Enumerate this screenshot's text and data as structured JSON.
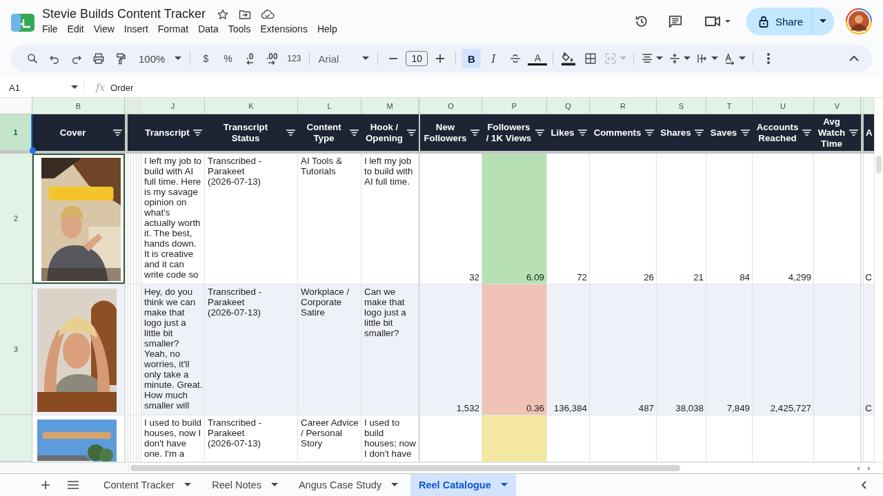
{
  "document": {
    "title": "Stevie Builds Content Tracker"
  },
  "menu": [
    "File",
    "Edit",
    "View",
    "Insert",
    "Format",
    "Data",
    "Tools",
    "Extensions",
    "Help"
  ],
  "share": {
    "label": "Share"
  },
  "toolbar": {
    "zoom": "100%",
    "currency": "$",
    "percent": "%",
    "decrease_decimals": ".0",
    "increase_decimals": ".00",
    "number_format": "123",
    "font": "Arial",
    "font_size": "10",
    "bold": {
      "label": "B",
      "selected": true
    },
    "italic": {
      "label": "I",
      "selected": false
    },
    "strikethrough": {
      "selected": false
    },
    "text_color": {
      "label": "A"
    },
    "merge": {
      "disabled": true
    }
  },
  "formula_bar": {
    "cell": "A1",
    "fx": "fx",
    "value": "Order"
  },
  "header_row": {
    "number": "1"
  },
  "columns": [
    {
      "letter": "B",
      "title": "Cover"
    },
    {
      "letter": "J",
      "title": "Transcript"
    },
    {
      "letter": "K",
      "title": "Transcript Status"
    },
    {
      "letter": "L",
      "title": "Content Type"
    },
    {
      "letter": "M",
      "title": "Hook / Opening"
    },
    {
      "letter": "O",
      "title": "New Followers"
    },
    {
      "letter": "P",
      "title": "Followers / 1K Views"
    },
    {
      "letter": "Q",
      "title": "Likes"
    },
    {
      "letter": "R",
      "title": "Comments"
    },
    {
      "letter": "S",
      "title": "Shares"
    },
    {
      "letter": "T",
      "title": "Saves"
    },
    {
      "letter": "U",
      "title": "Accounts Reached"
    },
    {
      "letter": "V",
      "title": "Avg Watch Time"
    },
    {
      "title": "A"
    }
  ],
  "rows": [
    {
      "number": "2",
      "cover": {
        "kind": "picture",
        "selected": true
      },
      "transcript": "I left my job to build with AI full time. Here is my savage opinion on what's actually worth it. The best, hands down. It is creative and it can write code so",
      "transcript_status": "Transcribed - Parakeet (2026-07-13)",
      "content_type": "AI Tools & Tutorials",
      "hook": "I left my job to build with AI full time.",
      "new_followers": "32",
      "followers_per_1k_views": {
        "text": "6.09",
        "color": "#b7e1b5"
      },
      "likes": "72",
      "comments": "26",
      "shares": "21",
      "saves": "84",
      "accounts_reached": "4,299",
      "column_w": "C"
    },
    {
      "number": "3",
      "cover": {
        "kind": "picture",
        "selected": false
      },
      "transcript": "Hey, do you think we can make that logo just a little bit smaller? Yeah, no worries, it'll only take a minute. Great. How much smaller will",
      "transcript_status": "Transcribed - Parakeet (2026-07-13)",
      "content_type": "Workplace / Corporate Satire",
      "hook": "Can we make that logo just a little bit smaller?",
      "new_followers": "1,532",
      "followers_per_1k_views": {
        "text": "0.36",
        "color": "#efc3b5"
      },
      "likes": "136,384",
      "comments": "487",
      "shares": "38,038",
      "saves": "7,849",
      "accounts_reached": "2,425,727",
      "column_w": "C"
    },
    {
      "cover": {
        "kind": "picture",
        "selected": false
      },
      "transcript": "I used to build houses, now I don't have one. I'm a",
      "transcript_status": "Transcribed - Parakeet (2026-07-13)",
      "content_type": "Career Advice / Personal Story",
      "hook": "I used to build houses; now I don't have",
      "followers_per_1k_views": {
        "color": "#f4e7a1"
      }
    }
  ],
  "sheet_tabs": [
    {
      "label": "Content Tracker",
      "selected": false
    },
    {
      "label": "Reel Notes",
      "selected": false
    },
    {
      "label": "Angus Case Study",
      "selected": false
    },
    {
      "label": "Reel Catalogue",
      "selected": true
    }
  ]
}
